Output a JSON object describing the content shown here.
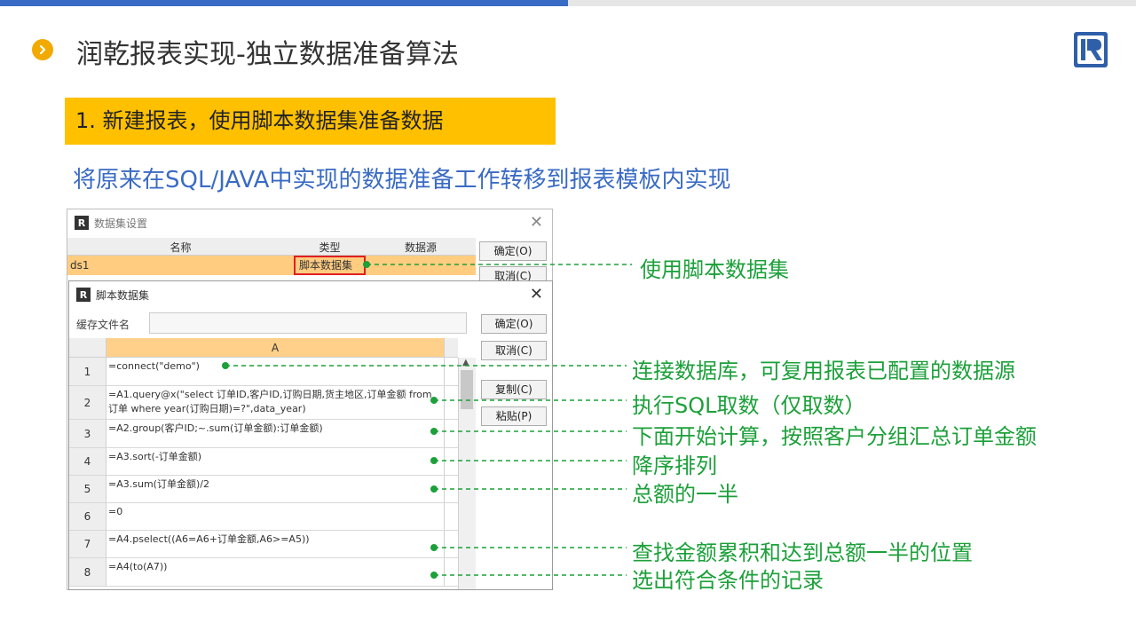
{
  "page": {
    "title": "润乾报表实现-独立数据准备算法",
    "step": "1. 新建报表，使用脚本数据集准备数据",
    "subtitle": "将原来在SQL/JAVA中实现的数据准备工作转移到报表模板内实现"
  },
  "colors": {
    "accent_blue": "#3a6bc4",
    "banner_yellow": "#ffc000",
    "annotation_green": "#1ca03a",
    "bullet_orange": "#f2a900"
  },
  "dataset_dialog": {
    "title": "数据集设置",
    "columns": [
      "名称",
      "类型",
      "数据源"
    ],
    "row": {
      "name": "ds1",
      "type": "脚本数据集",
      "source": ""
    },
    "ok_label": "确定(O)",
    "cancel_label": "取消(C)"
  },
  "script_dialog": {
    "title": "脚本数据集",
    "cache_label": "缓存文件名",
    "cache_value": "",
    "column_header": "A",
    "buttons": {
      "ok": "确定(O)",
      "cancel": "取消(C)",
      "copy": "复制(C)",
      "paste": "粘贴(P)"
    },
    "rows": [
      {
        "num": "1",
        "code": "=connect(\"demo\")"
      },
      {
        "num": "2",
        "code": "=A1.query@x(\"select 订单ID,客户ID,订购日期,货主地区,订单金额 from 订单 where year(订购日期)=?\",data_year)"
      },
      {
        "num": "3",
        "code": "=A2.group(客户ID;~.sum(订单金额):订单金额)"
      },
      {
        "num": "4",
        "code": "=A3.sort(-订单金额)"
      },
      {
        "num": "5",
        "code": "=A3.sum(订单金额)/2"
      },
      {
        "num": "6",
        "code": "=0"
      },
      {
        "num": "7",
        "code": "=A4.pselect((A6=A6+订单金额,A6>=A5))"
      },
      {
        "num": "8",
        "code": "=A4(to(A7))"
      }
    ]
  },
  "annotations": [
    "使用脚本数据集",
    "连接数据库，可复用报表已配置的数据源",
    "执行SQL取数（仅取数）",
    "下面开始计算，按照客户分组汇总订单金额",
    "降序排列",
    "总额的一半",
    "查找金额累积和达到总额一半的位置",
    "选出符合条件的记录"
  ],
  "icons": {
    "title_bullet": "chevron-right-icon",
    "logo": "raqsoft-logo-icon",
    "close": "close-icon"
  }
}
